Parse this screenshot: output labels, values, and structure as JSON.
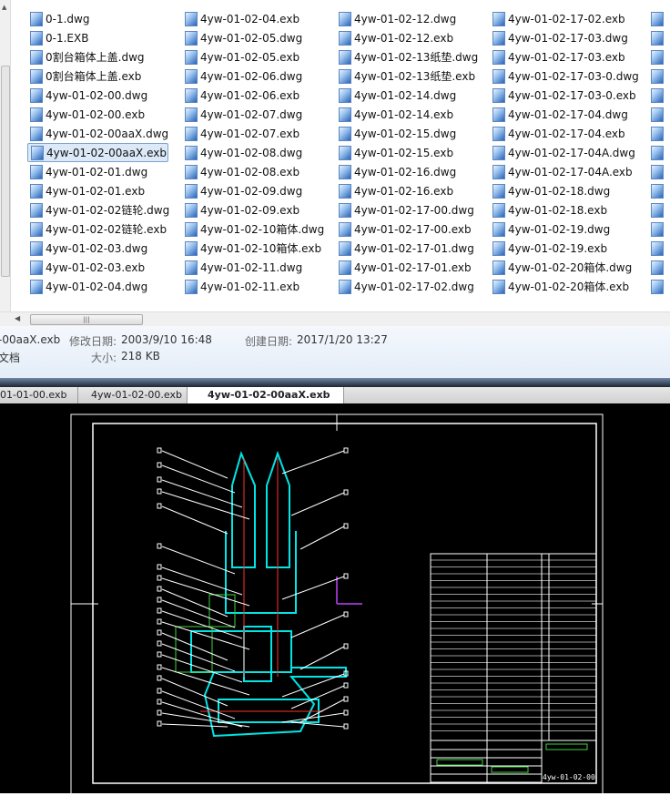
{
  "columns": [
    [
      "0-1.dwg",
      "0-1.EXB",
      "0割台箱体上盖.dwg",
      "0割台箱体上盖.exb",
      "4yw-01-02-00.dwg",
      "4yw-01-02-00.exb",
      "4yw-01-02-00aaX.dwg",
      "4yw-01-02-00aaX.exb",
      "4yw-01-02-01.dwg",
      "4yw-01-02-01.exb",
      "4yw-01-02-02链轮.dwg",
      "4yw-01-02-02链轮.exb",
      "4yw-01-02-03.dwg",
      "4yw-01-02-03.exb",
      "4yw-01-02-04.dwg"
    ],
    [
      "4yw-01-02-04.exb",
      "4yw-01-02-05.dwg",
      "4yw-01-02-05.exb",
      "4yw-01-02-06.dwg",
      "4yw-01-02-06.exb",
      "4yw-01-02-07.dwg",
      "4yw-01-02-07.exb",
      "4yw-01-02-08.dwg",
      "4yw-01-02-08.exb",
      "4yw-01-02-09.dwg",
      "4yw-01-02-09.exb",
      "4yw-01-02-10箱体.dwg",
      "4yw-01-02-10箱体.exb",
      "4yw-01-02-11.dwg",
      "4yw-01-02-11.exb"
    ],
    [
      "4yw-01-02-12.dwg",
      "4yw-01-02-12.exb",
      "4yw-01-02-13纸垫.dwg",
      "4yw-01-02-13纸垫.exb",
      "4yw-01-02-14.dwg",
      "4yw-01-02-14.exb",
      "4yw-01-02-15.dwg",
      "4yw-01-02-15.exb",
      "4yw-01-02-16.dwg",
      "4yw-01-02-16.exb",
      "4yw-01-02-17-00.dwg",
      "4yw-01-02-17-00.exb",
      "4yw-01-02-17-01.dwg",
      "4yw-01-02-17-01.exb",
      "4yw-01-02-17-02.dwg"
    ],
    [
      "4yw-01-02-17-02.exb",
      "4yw-01-02-17-03.dwg",
      "4yw-01-02-17-03.exb",
      "4yw-01-02-17-03-0.dwg",
      "4yw-01-02-17-03-0.exb",
      "4yw-01-02-17-04.dwg",
      "4yw-01-02-17-04.exb",
      "4yw-01-02-17-04A.dwg",
      "4yw-01-02-17-04A.exb",
      "4yw-01-02-18.dwg",
      "4yw-01-02-18.exb",
      "4yw-01-02-19.dwg",
      "4yw-01-02-19.exb",
      "4yw-01-02-20箱体.dwg",
      "4yw-01-02-20箱体.exb"
    ]
  ],
  "selected": "4yw-01-02-00aaX.exb",
  "details": {
    "name": "-00aaX.exb",
    "type": "文档",
    "modified_label": "修改日期:",
    "modified": "2003/9/10 16:48",
    "created_label": "创建日期:",
    "created": "2017/1/20 13:27",
    "size_label": "大小:",
    "size": "218 KB"
  },
  "tabs": [
    {
      "label": "01-01-00.exb"
    },
    {
      "label": "4yw-01-02-00.exb"
    },
    {
      "label": "4yw-01-02-00aaX.exb",
      "active": true
    }
  ],
  "tab_close": "×",
  "drawing": {
    "title_block_code": "4yw-01-02-00"
  },
  "colors": {
    "cad_bg": "#000000",
    "part": "#00e5e5",
    "table_green": "#3fd43f",
    "selection": "#dbe9f9"
  }
}
